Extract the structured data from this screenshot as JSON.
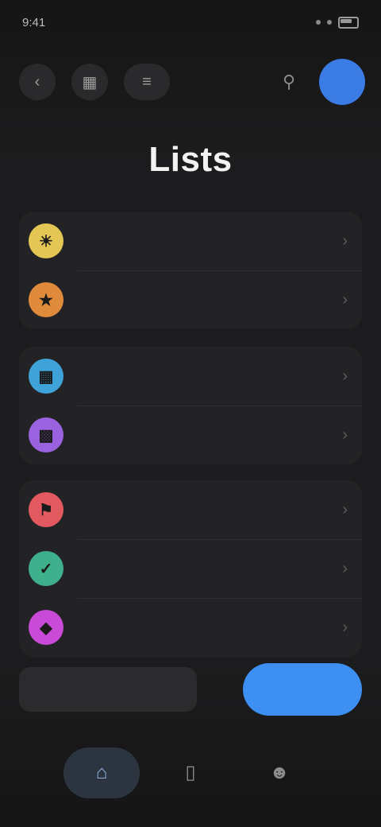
{
  "status_bar": {
    "time": "9:41",
    "signal_icon": "signal-icon",
    "wifi_icon": "wifi-icon",
    "battery_icon": "battery-icon"
  },
  "top_bar": {
    "left_icons": [
      "back-icon",
      "grid-icon",
      "filter-icon"
    ],
    "right_icons": [
      "search-icon"
    ],
    "avatar_initial": ""
  },
  "page": {
    "title": "Lists"
  },
  "sections": [
    {
      "rows": [
        {
          "label": "",
          "value": "",
          "color": "#e3c654",
          "icon": "sun-icon"
        },
        {
          "label": "",
          "value": "",
          "color": "#e08a3c",
          "icon": "star-icon"
        }
      ]
    },
    {
      "rows": [
        {
          "label": "",
          "value": "",
          "color": "#3fa3d9",
          "icon": "calendar-icon"
        },
        {
          "label": "",
          "value": "",
          "color": "#9b62e0",
          "icon": "inbox-icon"
        }
      ]
    },
    {
      "rows": [
        {
          "label": "",
          "value": "",
          "color": "#e25a5f",
          "icon": "flag-icon"
        },
        {
          "label": "",
          "value": "",
          "color": "#3fb08c",
          "icon": "check-icon"
        },
        {
          "label": "",
          "value": "",
          "color": "#c94ad6",
          "icon": "tag-icon"
        }
      ]
    }
  ],
  "bottom": {
    "search_placeholder": "",
    "primary_label": ""
  },
  "nav": {
    "items": [
      {
        "label": "",
        "icon": "home-icon"
      },
      {
        "label": "",
        "icon": "document-icon"
      },
      {
        "label": "",
        "icon": "person-icon"
      }
    ]
  },
  "colors": {
    "accent": "#3d8ff2",
    "background": "#1c1c1e",
    "card": "#232325"
  }
}
